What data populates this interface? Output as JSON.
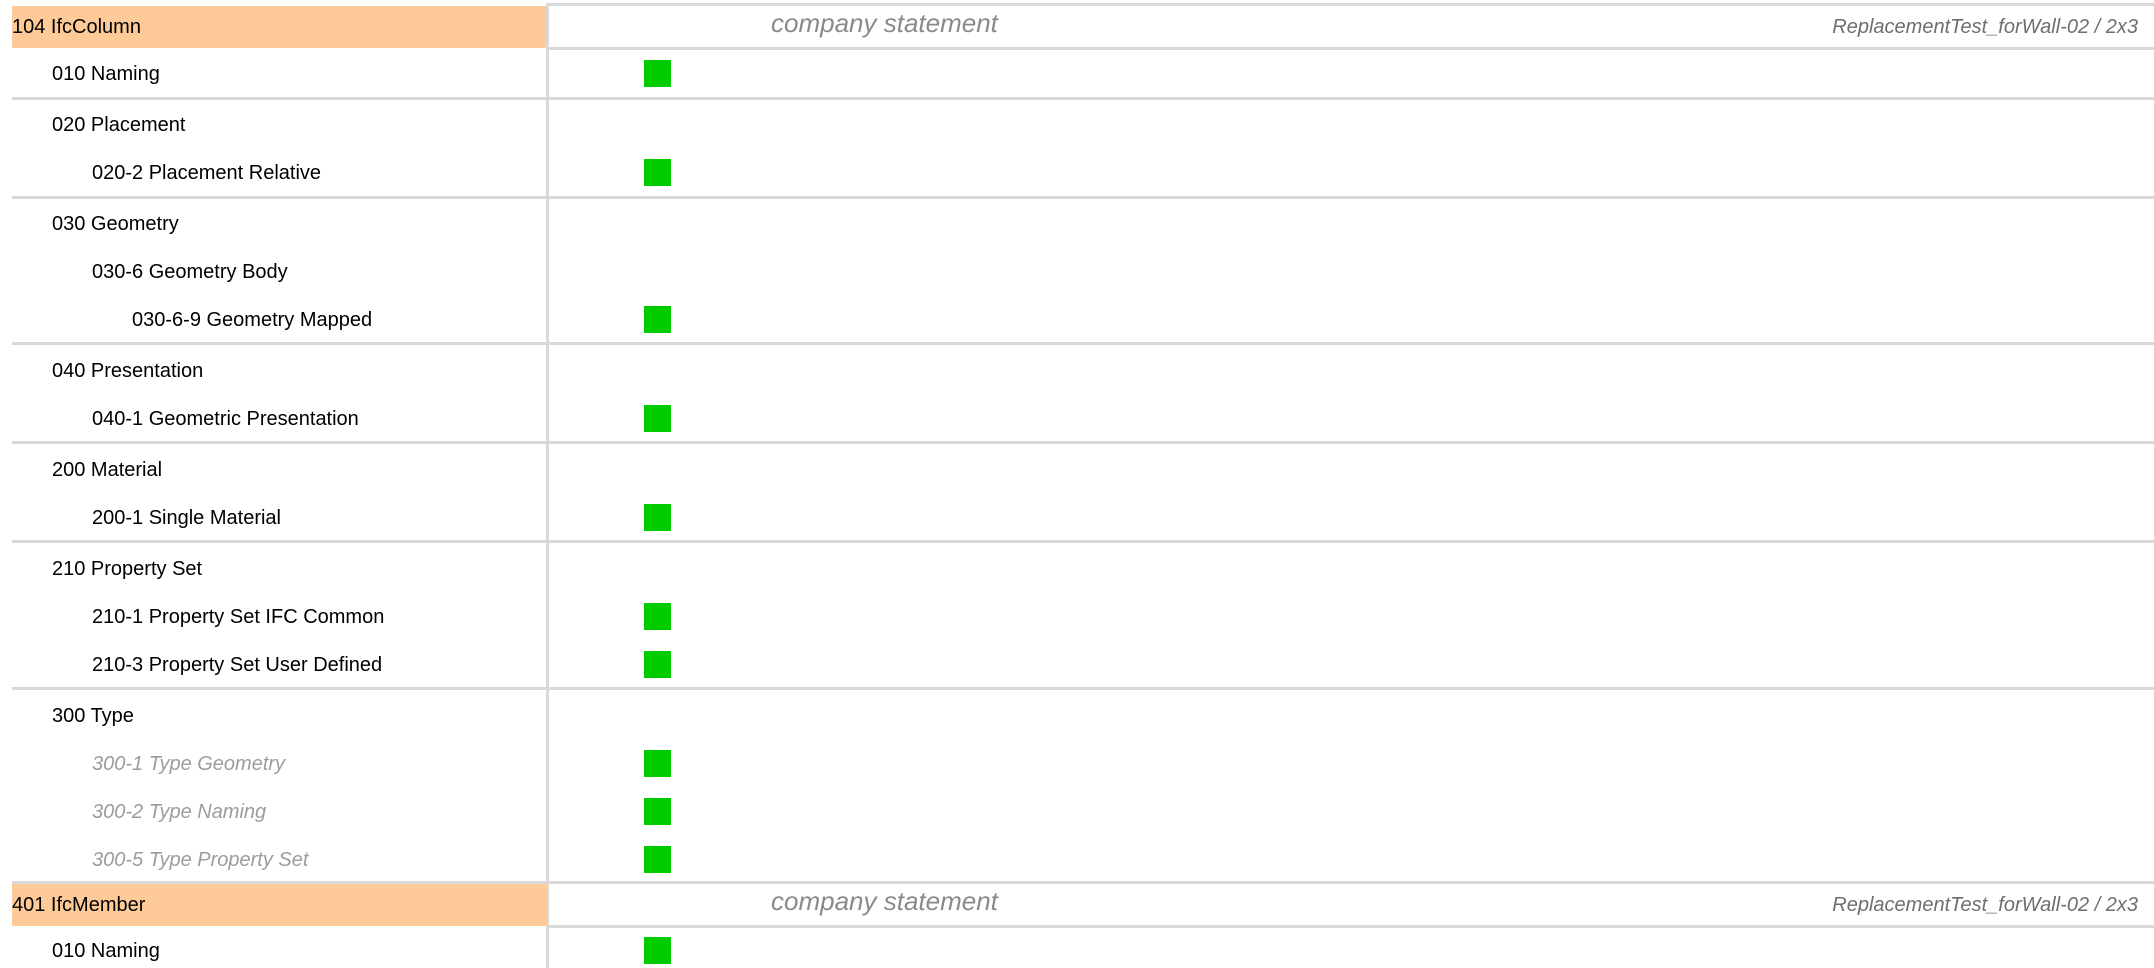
{
  "sections": [
    {
      "id": "ifccolumn",
      "title": "104 IfcColumn",
      "statement": "company statement",
      "source": "ReplacementTest_forWall-02 / 2x3",
      "status_color": "#00cc00",
      "header_color": "#fecb98"
    },
    {
      "id": "ifcmember",
      "title": "401 IfcMember",
      "statement": "company statement",
      "source": "ReplacementTest_forWall-02 / 2x3"
    }
  ],
  "column_rows": [
    {
      "label": "010 Naming",
      "status": "passed"
    },
    {
      "label": "020 Placement"
    },
    {
      "label": "020-2 Placement Relative",
      "status": "passed"
    },
    {
      "label": "030 Geometry"
    },
    {
      "label": "030-6 Geometry Body"
    },
    {
      "label": "030-6-9 Geometry Mapped",
      "status": "passed"
    },
    {
      "label": "040 Presentation"
    },
    {
      "label": "040-1 Geometric Presentation",
      "status": "passed"
    },
    {
      "label": "200 Material"
    },
    {
      "label": "200-1 Single Material",
      "status": "passed"
    },
    {
      "label": "210 Property Set"
    },
    {
      "label": "210-1 Property Set IFC Common",
      "status": "passed"
    },
    {
      "label": "210-3 Property Set User Defined",
      "status": "passed"
    },
    {
      "label": "300 Type"
    },
    {
      "label": "300-1 Type Geometry",
      "status": "passed"
    },
    {
      "label": "300-2 Type Naming",
      "status": "passed"
    },
    {
      "label": "300-5 Type Property Set",
      "status": "passed"
    }
  ],
  "member_rows": [
    {
      "label": "010 Naming",
      "status": "passed"
    }
  ]
}
